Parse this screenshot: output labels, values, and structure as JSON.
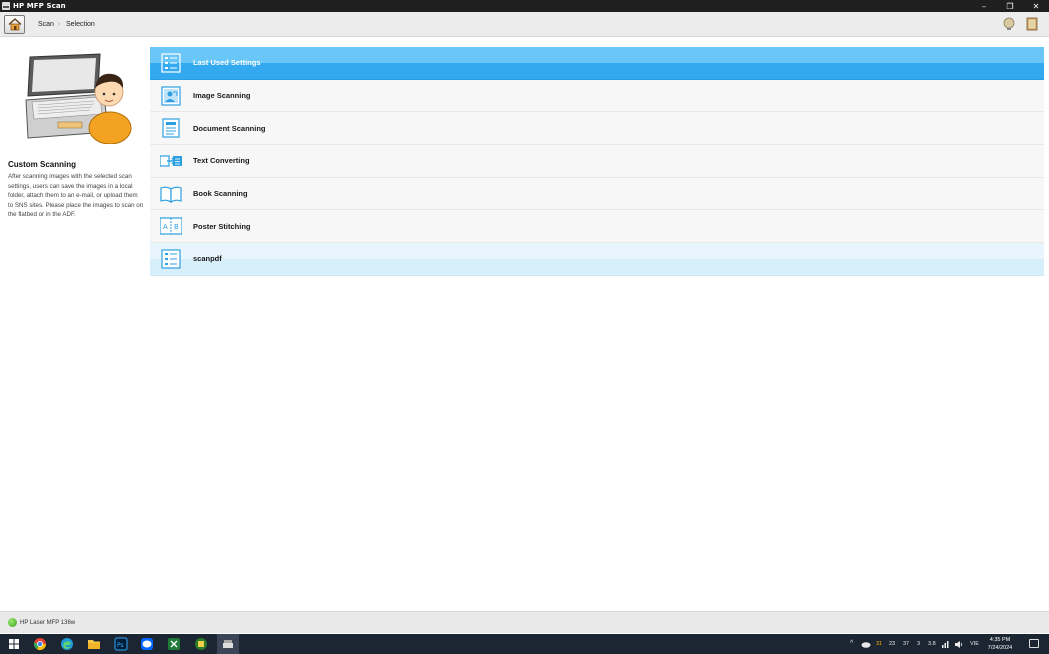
{
  "window": {
    "title": "HP MFP Scan",
    "buttons": [
      "–",
      "❐",
      "✕"
    ]
  },
  "nav": {
    "breadcrumb": [
      "Scan",
      "Selection"
    ],
    "separator": "›"
  },
  "left_panel": {
    "title": "Custom Scanning",
    "description": "After scanning images with the selected scan settings, users can save the images in a local folder, attach them to an e-mail, or upload them to SNS sites. Please place the images to scan on the flatbed or in the ADF."
  },
  "menu": {
    "items": [
      {
        "label": "Last Used Settings",
        "icon": "settings-list-icon",
        "state": "selected"
      },
      {
        "label": "Image Scanning",
        "icon": "image-scan-icon",
        "state": "normal"
      },
      {
        "label": "Document Scanning",
        "icon": "document-icon",
        "state": "normal"
      },
      {
        "label": "Text Converting",
        "icon": "text-convert-icon",
        "state": "normal"
      },
      {
        "label": "Book Scanning",
        "icon": "book-icon",
        "state": "normal"
      },
      {
        "label": "Poster Stitching",
        "icon": "poster-stitch-icon",
        "state": "normal"
      },
      {
        "label": "scanpdf",
        "icon": "settings-list-icon",
        "state": "highlight"
      }
    ]
  },
  "status": {
    "device": "HP Laser MFP 136w"
  },
  "taskbar": {
    "tray": {
      "weather": "31",
      "nums": [
        "23",
        "37",
        "3",
        "3.8"
      ],
      "lang": "VIE",
      "time": "4:35 PM",
      "date": "7/24/2024"
    }
  },
  "colors": {
    "accent": "#33aaf0",
    "accent_light": "#69c6f7",
    "highlight": "#d7eefb"
  }
}
